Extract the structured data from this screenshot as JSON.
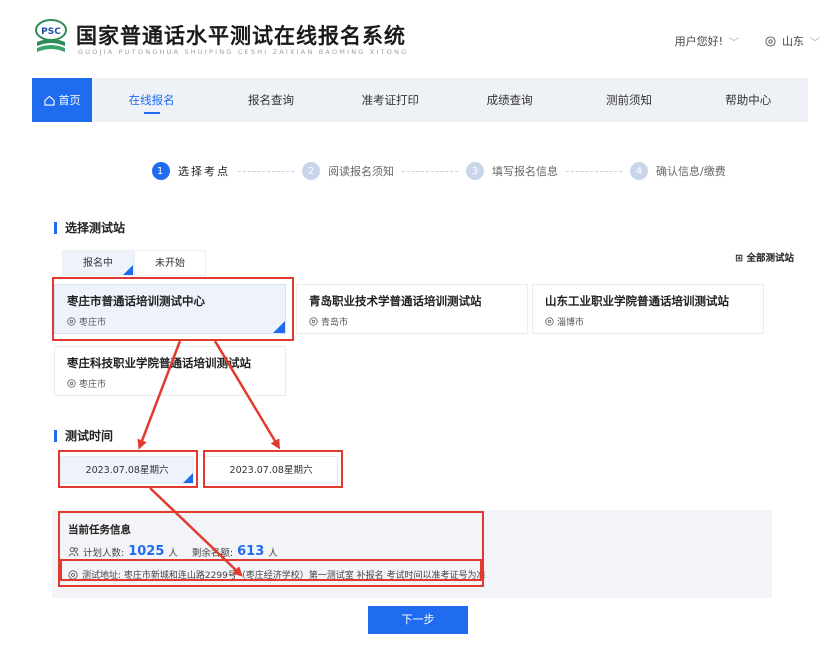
{
  "header": {
    "logo_text": "PSC",
    "title": "国家普通话水平测试在线报名系统",
    "subtitle": "GUOJIA PUTONGHUA SHUIPING CESHI ZAIXIAN BAOMING XITONG",
    "greeting": "用户您好!",
    "region": "山东"
  },
  "nav": {
    "home": "首页",
    "items": [
      "在线报名",
      "报名查询",
      "准考证打印",
      "成绩查询",
      "测前须知",
      "帮助中心"
    ]
  },
  "steps": [
    {
      "num": "1",
      "label": "选择考点"
    },
    {
      "num": "2",
      "label": "阅读报名须知"
    },
    {
      "num": "3",
      "label": "填写报名信息"
    },
    {
      "num": "4",
      "label": "确认信息/缴费"
    }
  ],
  "select_station": {
    "title": "选择测试站",
    "tabs": [
      "报名中",
      "未开始"
    ],
    "all_label": "全部测试站",
    "stations": [
      {
        "name": "枣庄市普通话培训测试中心",
        "city": "枣庄市"
      },
      {
        "name": "青岛职业技术学普通话培训测试站",
        "city": "青岛市"
      },
      {
        "name": "山东工业职业学院普通话培训测试站",
        "city": "淄博市"
      },
      {
        "name": "枣庄科技职业学院普通话培训测试站",
        "city": "枣庄市"
      }
    ]
  },
  "test_time": {
    "title": "测试时间",
    "dates": [
      "2023.07.08星期六",
      "2023.07.08星期六"
    ]
  },
  "task": {
    "title": "当前任务信息",
    "planned_label": "计划人数:",
    "planned_value": "1025",
    "planned_unit": "人",
    "remain_label": "剩余名额:",
    "remain_value": "613",
    "remain_unit": "人",
    "address": "测试地址: 枣庄市新城和连山路2299号（枣庄经济学校）第一测试室 补报名 考试时间以准考证号为准"
  },
  "next_button": "下一步",
  "colors": {
    "accent": "#1f6cf0",
    "annotation": "#e23a2e"
  }
}
